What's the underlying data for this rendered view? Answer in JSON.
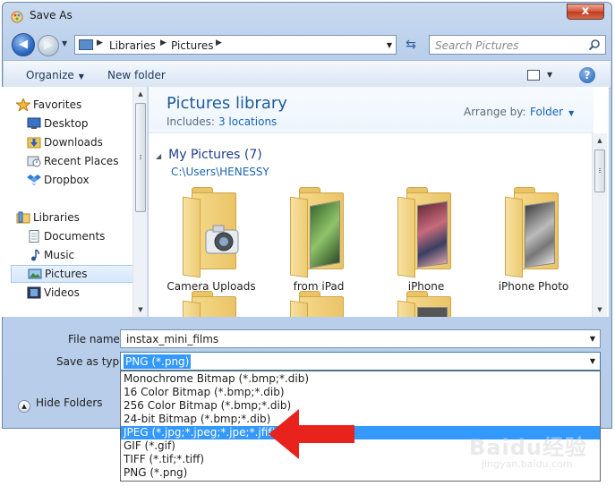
{
  "window": {
    "title": "Save As",
    "close_glyph": "x"
  },
  "address_bar": {
    "crumbs": [
      "Libraries",
      "Pictures"
    ],
    "search_placeholder": "Search Pictures"
  },
  "toolbar": {
    "organize_label": "Organize",
    "new_folder_label": "New folder"
  },
  "sidebar": {
    "favorites_label": "Favorites",
    "favorites": [
      {
        "label": "Desktop",
        "icon": "desktop-icon"
      },
      {
        "label": "Downloads",
        "icon": "downloads-icon"
      },
      {
        "label": "Recent Places",
        "icon": "recent-places-icon"
      },
      {
        "label": "Dropbox",
        "icon": "dropbox-icon"
      }
    ],
    "libraries_label": "Libraries",
    "libraries": [
      {
        "label": "Documents",
        "icon": "documents-icon"
      },
      {
        "label": "Music",
        "icon": "music-icon"
      },
      {
        "label": "Pictures",
        "icon": "pictures-icon",
        "selected": true
      },
      {
        "label": "Videos",
        "icon": "videos-icon"
      }
    ]
  },
  "library": {
    "title": "Pictures library",
    "includes_label": "Includes:",
    "includes_link": "3 locations",
    "arrange_label": "Arrange by:",
    "arrange_value": "Folder"
  },
  "group": {
    "name": "My Pictures (7)",
    "path": "C:\\Users\\HENESSY"
  },
  "folders": [
    {
      "name": "Camera Uploads"
    },
    {
      "name": "from iPad"
    },
    {
      "name": "iPhone"
    },
    {
      "name": "iPhone Photo"
    }
  ],
  "form": {
    "filename_label": "File name:",
    "filename_value": "instax_mini_films",
    "savetype_label": "Save as type:",
    "savetype_value": "PNG (*.png)",
    "hide_folders_label": "Hide Folders"
  },
  "savetype_options": [
    "Monochrome Bitmap (*.bmp;*.dib)",
    "16 Color Bitmap (*.bmp;*.dib)",
    "256 Color Bitmap (*.bmp;*.dib)",
    "24-bit Bitmap (*.bmp;*.dib)",
    "JPEG (*.jpg;*.jpeg;*.jpe;*.jfif)",
    "GIF (*.gif)",
    "TIFF (*.tif;*.tiff)",
    "PNG (*.png)"
  ],
  "highlighted_option_index": 4,
  "watermark": {
    "main": "Baidu经验",
    "sub": "jingyan.baidu.com"
  },
  "colors": {
    "accent": "#3399ff",
    "annotation_arrow": "#e8231e",
    "library_title": "#1e5b9c"
  }
}
